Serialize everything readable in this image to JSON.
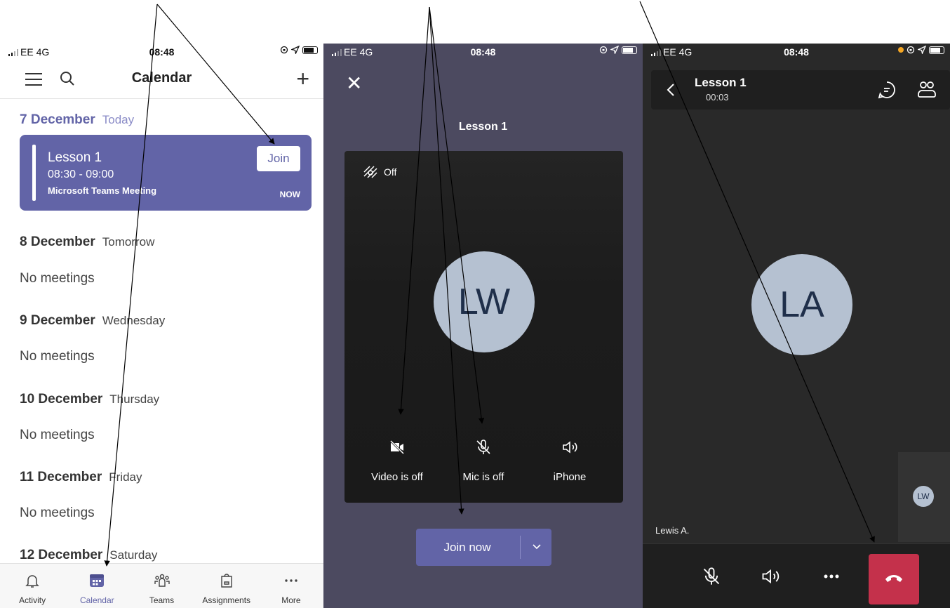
{
  "calendar_screen": {
    "status": {
      "carrier": "EE  4G",
      "time": "08:48"
    },
    "header": {
      "title": "Calendar"
    },
    "days": [
      {
        "date": "7 December",
        "label": "Today"
      },
      {
        "date": "8 December",
        "label": "Tomorrow",
        "empty": "No meetings"
      },
      {
        "date": "9 December",
        "label": "Wednesday",
        "empty": "No meetings"
      },
      {
        "date": "10 December",
        "label": "Thursday",
        "empty": "No meetings"
      },
      {
        "date": "11 December",
        "label": "Friday",
        "empty": "No meetings"
      },
      {
        "date": "12 December",
        "label": "Saturday"
      }
    ],
    "meeting": {
      "title": "Lesson 1",
      "time": "08:30 - 09:00",
      "subtitle": "Microsoft Teams Meeting",
      "badge": "NOW",
      "join_label": "Join"
    },
    "tabs": [
      {
        "label": "Activity",
        "icon": "bell-icon"
      },
      {
        "label": "Calendar",
        "icon": "calendar-icon",
        "active": true
      },
      {
        "label": "Teams",
        "icon": "teams-icon"
      },
      {
        "label": "Assignments",
        "icon": "assignments-icon"
      },
      {
        "label": "More",
        "icon": "more-icon"
      }
    ],
    "accent": "#6264a7"
  },
  "prejoin_screen": {
    "status": {
      "carrier": "EE  4G",
      "time": "08:48"
    },
    "title": "Lesson 1",
    "background_label": "Off",
    "avatar_initials": "LW",
    "controls": [
      {
        "label": "Video is off",
        "icon": "video-off-icon"
      },
      {
        "label": "Mic is off",
        "icon": "mic-off-icon"
      },
      {
        "label": "iPhone",
        "icon": "speaker-icon"
      }
    ],
    "join_now_label": "Join now"
  },
  "call_screen": {
    "status": {
      "carrier": "EE  4G",
      "time": "08:48"
    },
    "title": "Lesson 1",
    "timer": "00:03",
    "main_avatar_initials": "LA",
    "thumb_avatar_initials": "LW",
    "participant_name": "Lewis A.",
    "hangup_color": "#c4314b"
  }
}
